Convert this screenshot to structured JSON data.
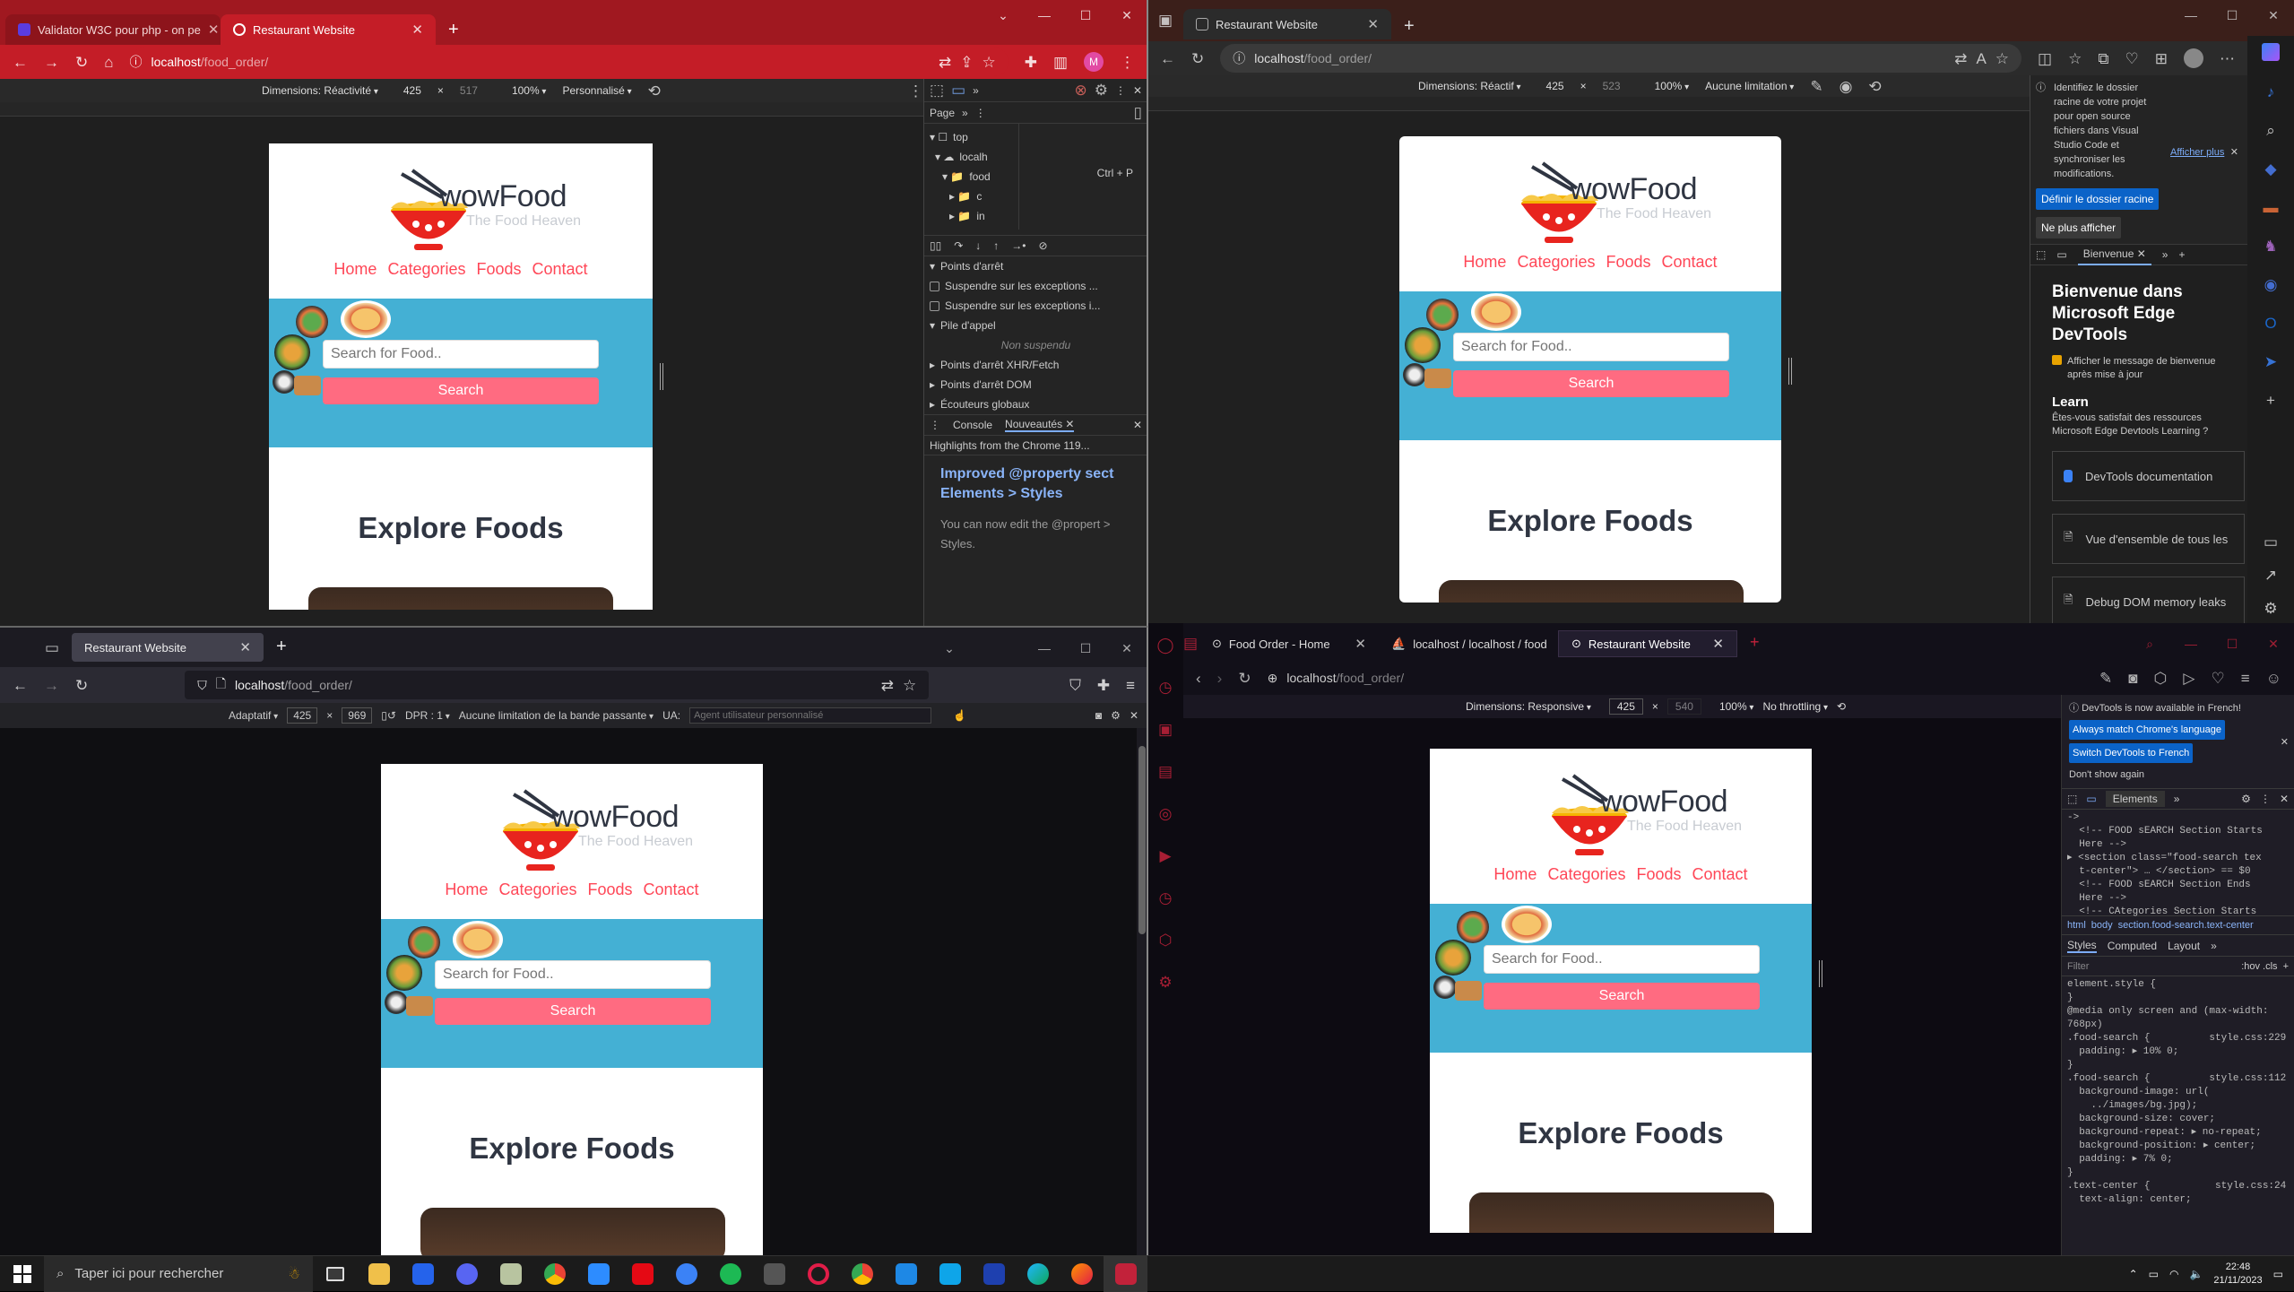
{
  "site": {
    "brand": "wowFood",
    "tagline": "The Food Heaven",
    "menu": [
      "Home",
      "Categories",
      "Foods",
      "Contact"
    ],
    "search_placeholder": "Search for Food..",
    "search_button": "Search",
    "section_title": "Explore Foods"
  },
  "tl": {
    "tabs": [
      {
        "title": "Validator W3C pour php - on pe"
      },
      {
        "title": "Restaurant Website"
      }
    ],
    "url_host": "localhost",
    "url_path": "/food_order/",
    "profile": "M",
    "dev": {
      "dimensions": "Dimensions: Réactivité",
      "width": "425",
      "height": "517",
      "zoom": "100%",
      "throttle": "Personnalisé"
    },
    "devtools": {
      "page_tab": "Page",
      "tree": [
        "top",
        "localh",
        "food",
        "c",
        "in"
      ],
      "shortcut": "Ctrl + P",
      "sections": [
        "Points d'arrêt",
        "Suspendre sur les exceptions ...",
        "Suspendre sur les exceptions i...",
        "Pile d'appel",
        "Non suspendu",
        "Points d'arrêt XHR/Fetch",
        "Points d'arrêt DOM",
        "Écouteurs globaux"
      ],
      "drawer_tabs": [
        "Console",
        "Nouveautés"
      ],
      "highlights": "Highlights from the Chrome 119...",
      "headline": "Improved @property sect Elements > Styles",
      "body": "You can now edit the @propert > Styles."
    }
  },
  "tr": {
    "tabs": [
      {
        "title": "Restaurant Website"
      }
    ],
    "url_host": "localhost",
    "url_path": "/food_order/",
    "dev": {
      "dimensions": "Dimensions: Réactif",
      "width": "425",
      "height": "523",
      "zoom": "100%",
      "throttle": "Aucune limitation"
    },
    "panel": {
      "notice": "Identifiez le dossier racine de votre projet pour open source fichiers dans Visual Studio Code et synchroniser les modifications.",
      "more": "Afficher plus",
      "btn_root": "Définir le dossier racine",
      "btn_hide": "Ne plus afficher",
      "tab": "Bienvenue",
      "welcome": "Bienvenue dans Microsoft Edge DevTools",
      "checkbox": "Afficher le message de bienvenue après mise à jour",
      "learn": "Learn",
      "learn_q": "Êtes-vous satisfait des ressources Microsoft Edge Devtools Learning ?",
      "cards": [
        "DevTools documentation",
        "Vue d'ensemble de tous les",
        "Debug DOM memory leaks"
      ]
    }
  },
  "bl": {
    "tabs": [
      {
        "title": "Restaurant Website"
      }
    ],
    "url_host": "localhost",
    "url_path": "/food_order/",
    "dev": {
      "mode": "Adaptatif",
      "width": "425",
      "height": "969",
      "dpr": "DPR : 1",
      "throttle": "Aucune limitation de la bande passante",
      "ua_label": "UA:",
      "ua_placeholder": "Agent utilisateur personnalisé"
    }
  },
  "br": {
    "tabs": [
      {
        "title": "Food Order - Home"
      },
      {
        "title": "localhost / localhost / food"
      },
      {
        "title": "Restaurant Website"
      }
    ],
    "url_host": "localhost",
    "url_path": "/food_order/",
    "dev": {
      "dimensions": "Dimensions: Responsive",
      "width": "425",
      "height": "540",
      "zoom": "100%",
      "throttle": "No throttling"
    },
    "panel": {
      "notice": "DevTools is now available in French!",
      "btn1": "Always match Chrome's language",
      "btn2": "Switch DevTools to French",
      "dont": "Don't show again",
      "elements_tab": "Elements",
      "dom": "->\n  <!-- FOOD sEARCH Section Starts\n  Here -->\n▸ <section class=\"food-search tex\n  t-center\"> … </section> == $0\n  <!-- FOOD sEARCH Section Ends\n  Here -->\n  <!-- CAtegories Section Starts",
      "crumbs": [
        "html",
        "body",
        "section.food-search.text-center"
      ],
      "style_tabs": [
        "Styles",
        "Computed",
        "Layout"
      ],
      "filter": "Filter",
      "hov": ":hov .cls",
      "css": "element.style {\n}\n@media only screen and (max-width:\n768px)\n.food-search {          style.css:229\n  padding: ▸ 10% 0;\n}\n.food-search {          style.css:112\n  background-image: url(\n    ../images/bg.jpg);\n  background-size: cover;\n  background-repeat: ▸ no-repeat;\n  background-position: ▸ center;\n  padding: ▸ 7% 0;\n}\n.text-center {           style.css:24\n  text-align: center;"
    }
  },
  "taskbar": {
    "search": "Taper ici pour rechercher",
    "time": "22:48",
    "date": "21/11/2023"
  }
}
